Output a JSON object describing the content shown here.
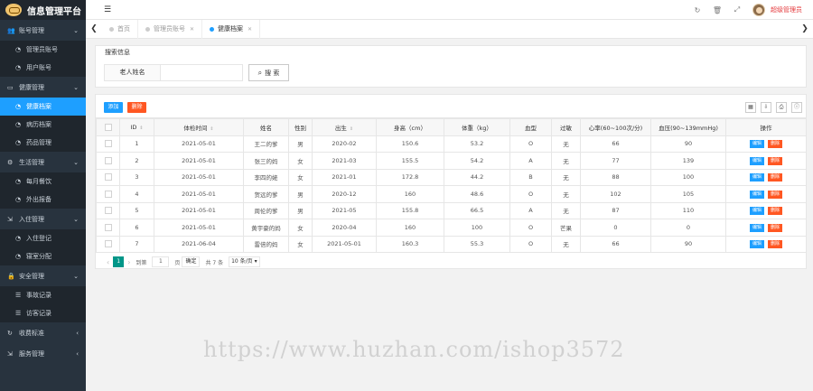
{
  "app": {
    "title": "信息管理平台"
  },
  "sidebar": {
    "groups": [
      {
        "label": "账号管理",
        "icon": "user-group-icon",
        "items": [
          {
            "label": "管理员账号",
            "icon": "dashboard-icon"
          },
          {
            "label": "用户账号",
            "icon": "dashboard-icon"
          }
        ]
      },
      {
        "label": "健康管理",
        "icon": "window-icon",
        "items": [
          {
            "label": "健康档案",
            "icon": "dashboard-icon",
            "active": true
          },
          {
            "label": "病历档案",
            "icon": "dashboard-icon"
          },
          {
            "label": "药品管理",
            "icon": "dashboard-icon"
          }
        ]
      },
      {
        "label": "生活管理",
        "icon": "gear-icon",
        "items": [
          {
            "label": "每月餐饮",
            "icon": "dashboard-icon"
          },
          {
            "label": "外出报备",
            "icon": "dashboard-icon"
          }
        ]
      },
      {
        "label": "入住管理",
        "icon": "door-icon",
        "items": [
          {
            "label": "入住登记",
            "icon": "dashboard-icon"
          },
          {
            "label": "寝室分配",
            "icon": "dashboard-icon"
          }
        ]
      },
      {
        "label": "安全管理",
        "icon": "lock-icon",
        "items": [
          {
            "label": "事故记录",
            "icon": "list-icon"
          },
          {
            "label": "访客记录",
            "icon": "list-icon"
          }
        ]
      },
      {
        "label": "收费标准",
        "icon": "refresh-icon",
        "items": []
      },
      {
        "label": "服务管理",
        "icon": "door-icon",
        "items": []
      }
    ]
  },
  "header": {
    "user_name": "超级管理员"
  },
  "tabs": [
    {
      "label": "首页",
      "closable": false,
      "active": false
    },
    {
      "label": "管理员账号",
      "closable": true,
      "active": false
    },
    {
      "label": "健康档案",
      "closable": true,
      "active": true
    }
  ],
  "search": {
    "legend": "搜索信息",
    "field_label": "老人姓名",
    "value": "",
    "button_label": "搜 索"
  },
  "toolbar": {
    "add_label": "添加",
    "delete_label": "删除"
  },
  "table": {
    "columns": [
      "ID",
      "体检时间",
      "姓名",
      "性别",
      "出生",
      "身高（cm）",
      "体重（kg）",
      "血型",
      "过敏",
      "心率(60~100次/分)",
      "血压(90~139mmHg)",
      "操作"
    ],
    "rows": [
      [
        "1",
        "2021-05-01",
        "王二的爹",
        "男",
        "2020-02",
        "150.6",
        "53.2",
        "O",
        "无",
        "66",
        "90"
      ],
      [
        "2",
        "2021-05-01",
        "张三的妈",
        "女",
        "2021-03",
        "155.5",
        "54.2",
        "A",
        "无",
        "77",
        "139"
      ],
      [
        "3",
        "2021-05-01",
        "李四的姥",
        "女",
        "2021-01",
        "172.8",
        "44.2",
        "B",
        "无",
        "88",
        "100"
      ],
      [
        "4",
        "2021-05-01",
        "贺远的爹",
        "男",
        "2020-12",
        "160",
        "48.6",
        "O",
        "无",
        "102",
        "105"
      ],
      [
        "5",
        "2021-05-01",
        "周伦的爹",
        "男",
        "2021-05",
        "155.8",
        "66.5",
        "A",
        "无",
        "87",
        "110"
      ],
      [
        "6",
        "2021-05-01",
        "黄宇豪的妈",
        "女",
        "2020-04",
        "160",
        "100",
        "O",
        "芒果",
        "0",
        "0"
      ],
      [
        "7",
        "2021-06-04",
        "雷倍的妈",
        "女",
        "2021-05-01",
        "160.3",
        "55.3",
        "O",
        "无",
        "66",
        "90"
      ]
    ],
    "edit_label": "编辑",
    "delete_label": "删除"
  },
  "pager": {
    "current": "1",
    "goto_label": "到第",
    "goto_value": "1",
    "page_unit": "页",
    "confirm_label": "确定",
    "total_label": "共 7 条",
    "page_size": "10 条/页"
  },
  "watermark": "https://www.huzhan.com/ishop3572"
}
